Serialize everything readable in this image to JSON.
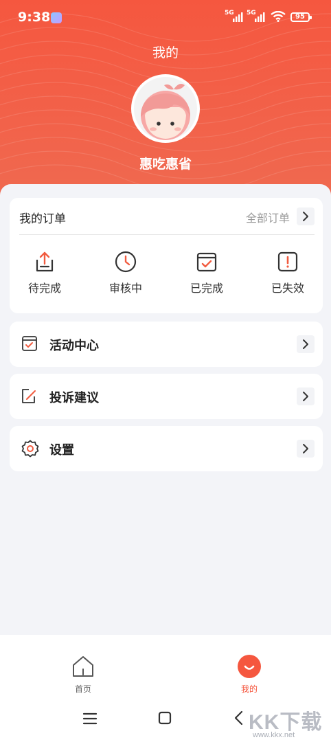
{
  "status_bar": {
    "time": "9:38",
    "network_1": "5G",
    "network_2": "5G",
    "battery": "95"
  },
  "header": {
    "title": "我的",
    "username": "惠吃惠省",
    "accent_color": "#f5573f"
  },
  "orders": {
    "title": "我的订单",
    "all_label": "全部订单",
    "items": [
      {
        "label": "待完成",
        "icon": "upload-tray-icon"
      },
      {
        "label": "审核中",
        "icon": "clock-icon"
      },
      {
        "label": "已完成",
        "icon": "calendar-check-icon"
      },
      {
        "label": "已失效",
        "icon": "exclamation-box-icon"
      }
    ]
  },
  "menu": [
    {
      "label": "活动中心",
      "icon": "calendar-check-icon"
    },
    {
      "label": "投诉建议",
      "icon": "edit-note-icon"
    },
    {
      "label": "设置",
      "icon": "gear-icon"
    }
  ],
  "tabbar": {
    "home_label": "首页",
    "mine_label": "我的"
  },
  "watermark": {
    "text": "KK下载",
    "url": "www.kkx.net"
  }
}
